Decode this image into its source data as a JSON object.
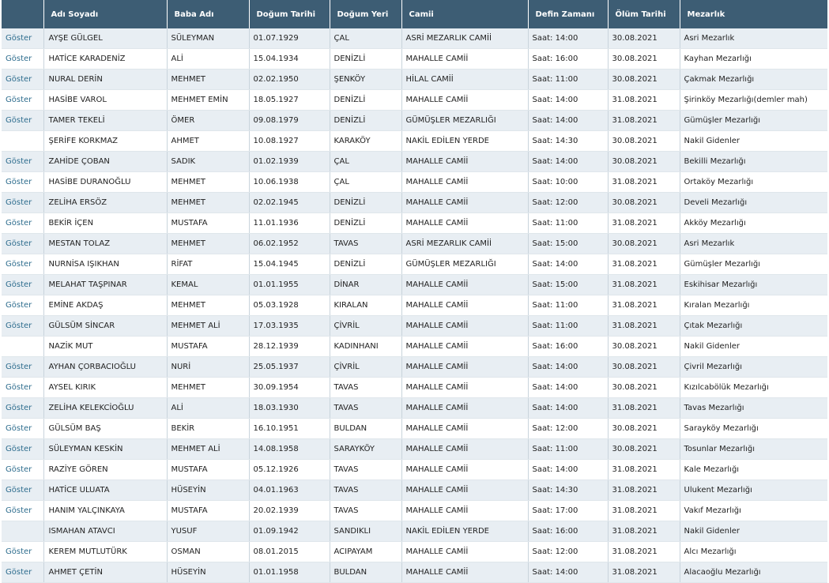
{
  "headers": [
    "",
    "Adı Soyadı",
    "Baba Adı",
    "Doğum Tarihi",
    "Doğum Yeri",
    "Camii",
    "Defin Zamanı",
    "Ölüm Tarihi",
    "Mezarlık"
  ],
  "rows": [
    {
      "action": "Göster",
      "name": "AYŞE GÜLGEL",
      "father": "SÜLEYMAN",
      "birth_date": "01.07.1929",
      "birth_place": "ÇAL",
      "mosque": "ASRİ MEZARLIK CAMİİ",
      "burial_time": "Saat: 14:00",
      "death_date": "30.08.2021",
      "cemetery": "Asri Mezarlık"
    },
    {
      "action": "Göster",
      "name": "HATİCE KARADENİZ",
      "father": "ALİ",
      "birth_date": "15.04.1934",
      "birth_place": "DENİZLİ",
      "mosque": "MAHALLE CAMİİ",
      "burial_time": "Saat: 16:00",
      "death_date": "30.08.2021",
      "cemetery": "Kayhan Mezarlığı"
    },
    {
      "action": "Göster",
      "name": "NURAL DERİN",
      "father": "MEHMET",
      "birth_date": "02.02.1950",
      "birth_place": "ŞENKÖY",
      "mosque": "HİLAL CAMİİ",
      "burial_time": "Saat: 11:00",
      "death_date": "30.08.2021",
      "cemetery": "Çakmak Mezarlığı"
    },
    {
      "action": "Göster",
      "name": "HASİBE VAROL",
      "father": "MEHMET EMİN",
      "birth_date": "18.05.1927",
      "birth_place": "DENİZLİ",
      "mosque": "MAHALLE CAMİİ",
      "burial_time": "Saat: 14:00",
      "death_date": "31.08.2021",
      "cemetery": "Şirinköy Mezarlığı(demler mah)"
    },
    {
      "action": "Göster",
      "name": "TAMER TEKELİ",
      "father": "ÖMER",
      "birth_date": "09.08.1979",
      "birth_place": "DENİZLİ",
      "mosque": "GÜMÜŞLER MEZARLIĞI",
      "burial_time": "Saat: 14:00",
      "death_date": "31.08.2021",
      "cemetery": "Gümüşler Mezarlığı"
    },
    {
      "action": "",
      "name": "ŞERİFE KORKMAZ",
      "father": "AHMET",
      "birth_date": "10.08.1927",
      "birth_place": "KARAKÖY",
      "mosque": "NAKİL EDİLEN YERDE",
      "burial_time": "Saat: 14:30",
      "death_date": "30.08.2021",
      "cemetery": "Nakil Gidenler"
    },
    {
      "action": "Göster",
      "name": "ZAHİDE ÇOBAN",
      "father": "SADIK",
      "birth_date": "01.02.1939",
      "birth_place": "ÇAL",
      "mosque": "MAHALLE CAMİİ",
      "burial_time": "Saat: 14:00",
      "death_date": "30.08.2021",
      "cemetery": "Bekilli Mezarlığı"
    },
    {
      "action": "Göster",
      "name": "HASİBE DURANOĞLU",
      "father": "MEHMET",
      "birth_date": "10.06.1938",
      "birth_place": "ÇAL",
      "mosque": "MAHALLE CAMİİ",
      "burial_time": "Saat: 10:00",
      "death_date": "31.08.2021",
      "cemetery": "Ortaköy Mezarlığı"
    },
    {
      "action": "Göster",
      "name": "ZELİHA ERSÖZ",
      "father": "MEHMET",
      "birth_date": "02.02.1945",
      "birth_place": "DENİZLİ",
      "mosque": "MAHALLE CAMİİ",
      "burial_time": "Saat: 12:00",
      "death_date": "30.08.2021",
      "cemetery": "Develi Mezarlığı"
    },
    {
      "action": "Göster",
      "name": "BEKİR İÇEN",
      "father": "MUSTAFA",
      "birth_date": "11.01.1936",
      "birth_place": "DENİZLİ",
      "mosque": "MAHALLE CAMİİ",
      "burial_time": "Saat: 11:00",
      "death_date": "31.08.2021",
      "cemetery": "Akköy Mezarlığı"
    },
    {
      "action": "Göster",
      "name": "MESTAN TOLAZ",
      "father": "MEHMET",
      "birth_date": "06.02.1952",
      "birth_place": "TAVAS",
      "mosque": "ASRİ MEZARLIK CAMİİ",
      "burial_time": "Saat: 15:00",
      "death_date": "30.08.2021",
      "cemetery": "Asri Mezarlık"
    },
    {
      "action": "Göster",
      "name": "NURNİSA IŞIKHAN",
      "father": "RİFAT",
      "birth_date": "15.04.1945",
      "birth_place": "DENİZLİ",
      "mosque": "GÜMÜŞLER MEZARLIĞI",
      "burial_time": "Saat: 14:00",
      "death_date": "31.08.2021",
      "cemetery": "Gümüşler Mezarlığı"
    },
    {
      "action": "Göster",
      "name": "MELAHAT TAŞPINAR",
      "father": "KEMAL",
      "birth_date": "01.01.1955",
      "birth_place": "DİNAR",
      "mosque": "MAHALLE CAMİİ",
      "burial_time": "Saat: 15:00",
      "death_date": "31.08.2021",
      "cemetery": "Eskihisar Mezarlığı"
    },
    {
      "action": "Göster",
      "name": "EMİNE AKDAŞ",
      "father": "MEHMET",
      "birth_date": "05.03.1928",
      "birth_place": "KIRALAN",
      "mosque": "MAHALLE CAMİİ",
      "burial_time": "Saat: 11:00",
      "death_date": "31.08.2021",
      "cemetery": "Kıralan Mezarlığı"
    },
    {
      "action": "Göster",
      "name": "GÜLSÜM SİNCAR",
      "father": "MEHMET ALİ",
      "birth_date": "17.03.1935",
      "birth_place": "ÇİVRİL",
      "mosque": "MAHALLE CAMİİ",
      "burial_time": "Saat: 11:00",
      "death_date": "31.08.2021",
      "cemetery": "Çıtak Mezarlığı"
    },
    {
      "action": "",
      "name": "NAZİK MUT",
      "father": "MUSTAFA",
      "birth_date": "28.12.1939",
      "birth_place": "KADINHANI",
      "mosque": "MAHALLE CAMİİ",
      "burial_time": "Saat: 16:00",
      "death_date": "30.08.2021",
      "cemetery": "Nakil Gidenler"
    },
    {
      "action": "Göster",
      "name": "AYHAN ÇORBACIOĞLU",
      "father": "NURİ",
      "birth_date": "25.05.1937",
      "birth_place": "ÇİVRİL",
      "mosque": "MAHALLE CAMİİ",
      "burial_time": "Saat: 14:00",
      "death_date": "30.08.2021",
      "cemetery": "Çivril Mezarlığı"
    },
    {
      "action": "Göster",
      "name": "AYSEL KIRIK",
      "father": "MEHMET",
      "birth_date": "30.09.1954",
      "birth_place": "TAVAS",
      "mosque": "MAHALLE CAMİİ",
      "burial_time": "Saat: 14:00",
      "death_date": "30.08.2021",
      "cemetery": "Kızılcabölük Mezarlığı"
    },
    {
      "action": "Göster",
      "name": "ZELİHA KELEKCİOĞLU",
      "father": "ALİ",
      "birth_date": "18.03.1930",
      "birth_place": "TAVAS",
      "mosque": "MAHALLE CAMİİ",
      "burial_time": "Saat: 14:00",
      "death_date": "31.08.2021",
      "cemetery": "Tavas Mezarlığı"
    },
    {
      "action": "Göster",
      "name": "GÜLSÜM BAŞ",
      "father": "BEKİR",
      "birth_date": "16.10.1951",
      "birth_place": "BULDAN",
      "mosque": "MAHALLE CAMİİ",
      "burial_time": "Saat: 12:00",
      "death_date": "30.08.2021",
      "cemetery": "Sarayköy Mezarlığı"
    },
    {
      "action": "Göster",
      "name": "SÜLEYMAN KESKİN",
      "father": "MEHMET ALİ",
      "birth_date": "14.08.1958",
      "birth_place": "SARAYKÖY",
      "mosque": "MAHALLE CAMİİ",
      "burial_time": "Saat: 11:00",
      "death_date": "30.08.2021",
      "cemetery": "Tosunlar Mezarlığı"
    },
    {
      "action": "Göster",
      "name": "RAZİYE GÖREN",
      "father": "MUSTAFA",
      "birth_date": "05.12.1926",
      "birth_place": "TAVAS",
      "mosque": "MAHALLE CAMİİ",
      "burial_time": "Saat: 14:00",
      "death_date": "31.08.2021",
      "cemetery": "Kale Mezarlığı"
    },
    {
      "action": "Göster",
      "name": "HATİCE ULUATA",
      "father": "HÜSEYİN",
      "birth_date": "04.01.1963",
      "birth_place": "TAVAS",
      "mosque": "MAHALLE CAMİİ",
      "burial_time": "Saat: 14:30",
      "death_date": "31.08.2021",
      "cemetery": "Ulukent Mezarlığı"
    },
    {
      "action": "Göster",
      "name": "HANIM YALÇINKAYA",
      "father": "MUSTAFA",
      "birth_date": "20.02.1939",
      "birth_place": "TAVAS",
      "mosque": "MAHALLE CAMİİ",
      "burial_time": "Saat: 17:00",
      "death_date": "31.08.2021",
      "cemetery": "Vakıf Mezarlığı"
    },
    {
      "action": "",
      "name": "ISMAHAN ATAVCI",
      "father": "YUSUF",
      "birth_date": "01.09.1942",
      "birth_place": "SANDIKLI",
      "mosque": "NAKİL EDİLEN YERDE",
      "burial_time": "Saat: 16:00",
      "death_date": "31.08.2021",
      "cemetery": "Nakil Gidenler"
    },
    {
      "action": "Göster",
      "name": "KEREM MUTLUTÜRK",
      "father": "OSMAN",
      "birth_date": "08.01.2015",
      "birth_place": "ACIPAYAM",
      "mosque": "MAHALLE CAMİİ",
      "burial_time": "Saat: 12:00",
      "death_date": "31.08.2021",
      "cemetery": "Alcı Mezarlığı"
    },
    {
      "action": "Göster",
      "name": "AHMET ÇETİN",
      "father": "HÜSEYİN",
      "birth_date": "01.01.1958",
      "birth_place": "BULDAN",
      "mosque": "MAHALLE CAMİİ",
      "burial_time": "Saat: 14:00",
      "death_date": "31.08.2021",
      "cemetery": "Alacaoğlu Mezarlığı"
    }
  ]
}
